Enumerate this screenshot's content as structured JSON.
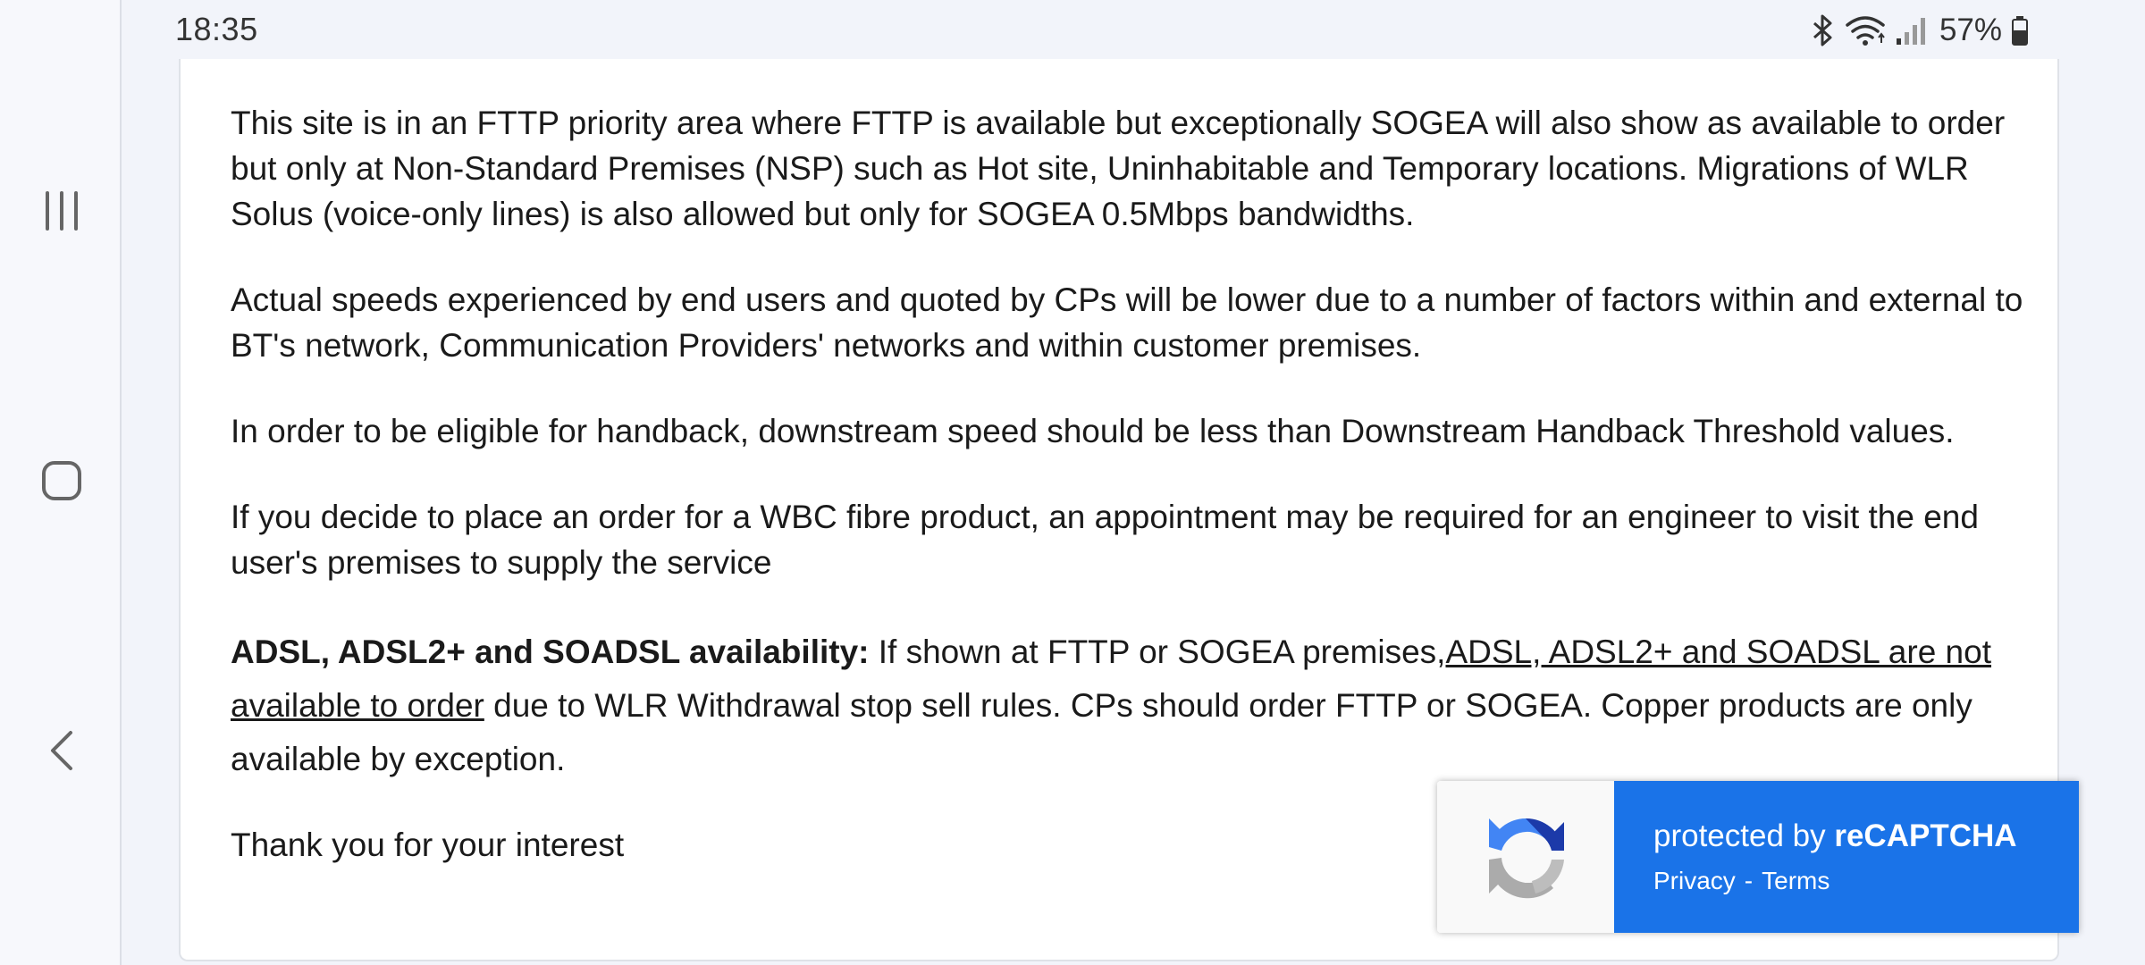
{
  "status_bar": {
    "time": "18:35",
    "battery_percent": "57%",
    "icons": [
      "bluetooth-icon",
      "wifi-icon",
      "signal-icon",
      "battery-icon"
    ]
  },
  "nav": {
    "icons": [
      "recent-apps-icon",
      "home-icon",
      "back-icon"
    ]
  },
  "content": {
    "p1": "This site is in an FTTP priority area where FTTP is available but exceptionally SOGEA will also show as available to order but only at Non-Standard Premises (NSP) such as Hot site, Uninhabitable and Temporary locations. Migrations of WLR Solus (voice-only lines) is also allowed but only for SOGEA 0.5Mbps bandwidths.",
    "p2": "Actual speeds experienced by end users and quoted by CPs will be lower due to a number of factors within and external to BT's network, Communication Providers' networks and within customer premises.",
    "p3": "In order to be eligible for handback, downstream speed should be less than Downstream Handback Threshold values.",
    "p4": "If you decide to place an order for a WBC fibre product, an appointment may be required for an engineer to visit the end user's premises to supply the service",
    "adsl_heading": "ADSL, ADSL2+ and SOADSL availability:",
    "adsl_text_1": " If shown at FTTP or SOGEA premises,",
    "adsl_link": "ADSL, ADSL2+ and SOADSL are not available to order",
    "adsl_text_2": " due to WLR Withdrawal stop sell rules. CPs should order FTTP or SOGEA. Copper products are only available by exception.",
    "thanks": "Thank you for your interest"
  },
  "recaptcha": {
    "protected_by": "protected by ",
    "brand": "reCAPTCHA",
    "privacy": "Privacy",
    "separator": "-",
    "terms": "Terms"
  },
  "colors": {
    "recaptcha_blue": "#1a73e8",
    "text": "#1a1a1a",
    "background": "#f2f4fa"
  }
}
